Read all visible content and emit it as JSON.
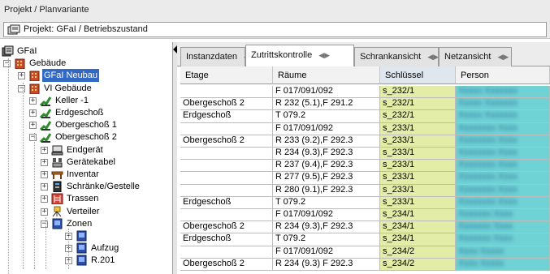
{
  "breadcrumb": "Projekt / Planvariante",
  "project": {
    "label": "Projekt: GFaI / Betriebszustand"
  },
  "tree": [
    {
      "label": "GFaI",
      "icon": "building-root-icon",
      "expander": "",
      "selected": false
    },
    {
      "label": "Gebäude",
      "icon": "building-icon",
      "expander": "-",
      "selected": false
    },
    {
      "label": "GFaI Neubau",
      "icon": "building-icon",
      "expander": "+",
      "selected": true
    },
    {
      "label": "VI Gebäude",
      "icon": "building-icon",
      "expander": "-",
      "selected": false
    },
    {
      "label": "Keller -1",
      "icon": "stairs-icon",
      "expander": "+",
      "selected": false
    },
    {
      "label": "Erdgeschoß",
      "icon": "stairs-icon",
      "expander": "+",
      "selected": false
    },
    {
      "label": "Obergeschoß 1",
      "icon": "stairs-icon",
      "expander": "+",
      "selected": false
    },
    {
      "label": "Obergeschoß 2",
      "icon": "stairs-icon",
      "expander": "-",
      "selected": false
    },
    {
      "label": "Endgerät",
      "icon": "computer-icon",
      "expander": "+",
      "selected": false
    },
    {
      "label": "Gerätekabel",
      "icon": "cable-icon",
      "expander": "+",
      "selected": false
    },
    {
      "label": "Inventar",
      "icon": "table-icon",
      "expander": "+",
      "selected": false
    },
    {
      "label": "Schränke/Gestelle",
      "icon": "cabinet-icon",
      "expander": "+",
      "selected": false
    },
    {
      "label": "Trassen",
      "icon": "ladder-icon",
      "expander": "+",
      "selected": false
    },
    {
      "label": "Verteiler",
      "icon": "distributor-icon",
      "expander": "+",
      "selected": false
    },
    {
      "label": "Zonen",
      "icon": "zone-icon",
      "expander": "-",
      "selected": false
    },
    {
      "label": "",
      "icon": "zone-icon",
      "expander": "+",
      "selected": false
    },
    {
      "label": "Aufzug",
      "icon": "zone-icon",
      "expander": "+",
      "selected": false
    },
    {
      "label": "R.201",
      "icon": "zone-icon",
      "expander": "+",
      "selected": false
    }
  ],
  "tabs": [
    {
      "label": "Instanzdaten",
      "active": false
    },
    {
      "label": "Zutrittskontrolle",
      "active": true
    },
    {
      "label": "Schrankansicht",
      "active": false
    },
    {
      "label": "Netzansicht",
      "active": false
    }
  ],
  "table": {
    "columns": [
      "Etage",
      "Räume",
      "Schlüssel",
      "Person"
    ],
    "sorted_column": "Schlüssel",
    "rows": [
      [
        "",
        "F 017/091/092",
        "s_232/1",
        "Xxxxx Xxxxxxx"
      ],
      [
        "Obergeschoß 2",
        "R 232 (5.1),F 291.2",
        "s_232/1",
        "Xxxxx Xxxxxxx"
      ],
      [
        "Erdgeschoß",
        "T 079.2",
        "s_232/1",
        "Xxxxx Xxxxxxx"
      ],
      [
        "",
        "F 017/091/092",
        "s_233/1",
        "Xxxxxxxx Xxxx"
      ],
      [
        "Obergeschoß 2",
        "R 233 (9.2),F 292.3",
        "s_233/1",
        "Xxxxxxxx Xxxx"
      ],
      [
        "",
        "R 234 (9.3),F 292.3",
        "s_233/1",
        "Xxxxxxxx Xxxx"
      ],
      [
        "",
        "R 237 (9.4),F 292.3",
        "s_233/1",
        "Xxxxxxxx Xxxx"
      ],
      [
        "",
        "R 277 (9.5),F 292.3",
        "s_233/1",
        "Xxxxxxxx Xxxx"
      ],
      [
        "",
        "R 280 (9.1),F 292.3",
        "s_233/1",
        "Xxxxxxxx Xxxx"
      ],
      [
        "Erdgeschoß",
        "T 079.2",
        "s_233/1",
        "Xxxxxxxx Xxxx"
      ],
      [
        "",
        "F 017/091/092",
        "s_234/1",
        "Xxxxxxx Xxxx"
      ],
      [
        "Obergeschoß 2",
        "R 234 (9.3),F 292.3",
        "s_234/1",
        "Xxxxxxx Xxxx"
      ],
      [
        "Erdgeschoß",
        "T 079.2",
        "s_234/1",
        "Xxxxxxx Xxxx"
      ],
      [
        "",
        "F 017/091/092",
        "s_234/2",
        "Xxxx Xxxxx"
      ],
      [
        "Obergeschoß 2",
        "R 234 (9.3) F 292.3",
        "s_234/2",
        "Xxxx Xxxxx"
      ]
    ]
  },
  "colors": {
    "selection": "#316ac5",
    "key_column": "#e3eda8",
    "person_column": "#6fd3d6"
  }
}
